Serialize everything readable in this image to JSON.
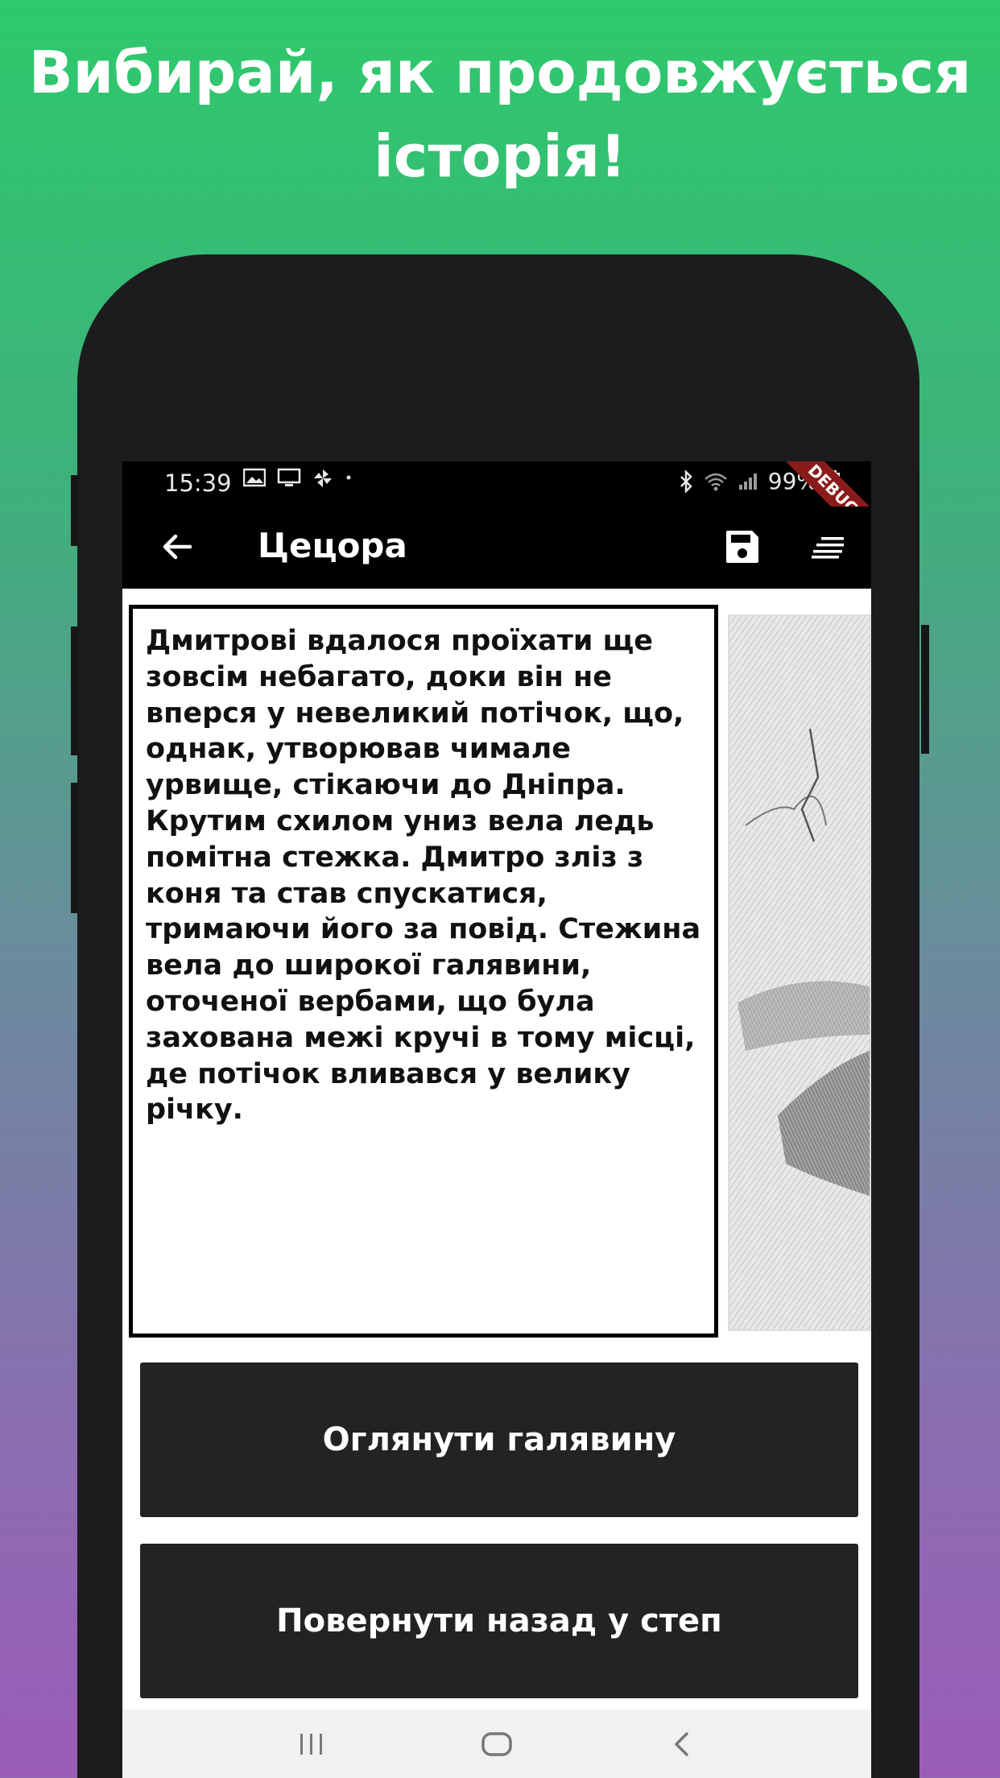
{
  "promo": {
    "headline_line1": "Вибирай, як продовжується",
    "headline_line2": "історія!"
  },
  "status_bar": {
    "time": "15:39",
    "battery": "99%",
    "debug_label": "DEBUG",
    "icons_left": [
      "gallery-icon",
      "cast-icon",
      "pinwheel-icon",
      "dot-icon"
    ],
    "icons_right": [
      "bluetooth-icon",
      "wifi-icon",
      "signal-icon",
      "battery-icon"
    ]
  },
  "app_bar": {
    "title": "Цецора",
    "back_icon": "arrow-left-icon",
    "save_icon": "save-icon",
    "menu_icon": "sort-menu-icon"
  },
  "story": {
    "text": "Дмитрові вдалося проїхати ще зовсім небагато, доки він не вперся у невеликий потічок, що, однак, утворював чимале урвище, стікаючи до Дніпра. Крутим схилом униз вела ледь помітна стежка. Дмитро зліз з коня та став спускатися, тримаючи його за повід. Стежина вела до широкої галявини, оточеної вербами, що була захована межі кручі в тому місці, де потічок вливався у велику річку."
  },
  "choices": [
    {
      "label": "Оглянути галявину"
    },
    {
      "label": "Повернути назад у степ"
    }
  ],
  "nav_bar": {
    "items": [
      "recents-icon",
      "home-icon",
      "back-icon"
    ]
  },
  "colors": {
    "gradient_top": "#2ec96c",
    "gradient_bottom": "#9b5cb8",
    "button_bg": "#232323",
    "app_bar_bg": "#000000"
  }
}
